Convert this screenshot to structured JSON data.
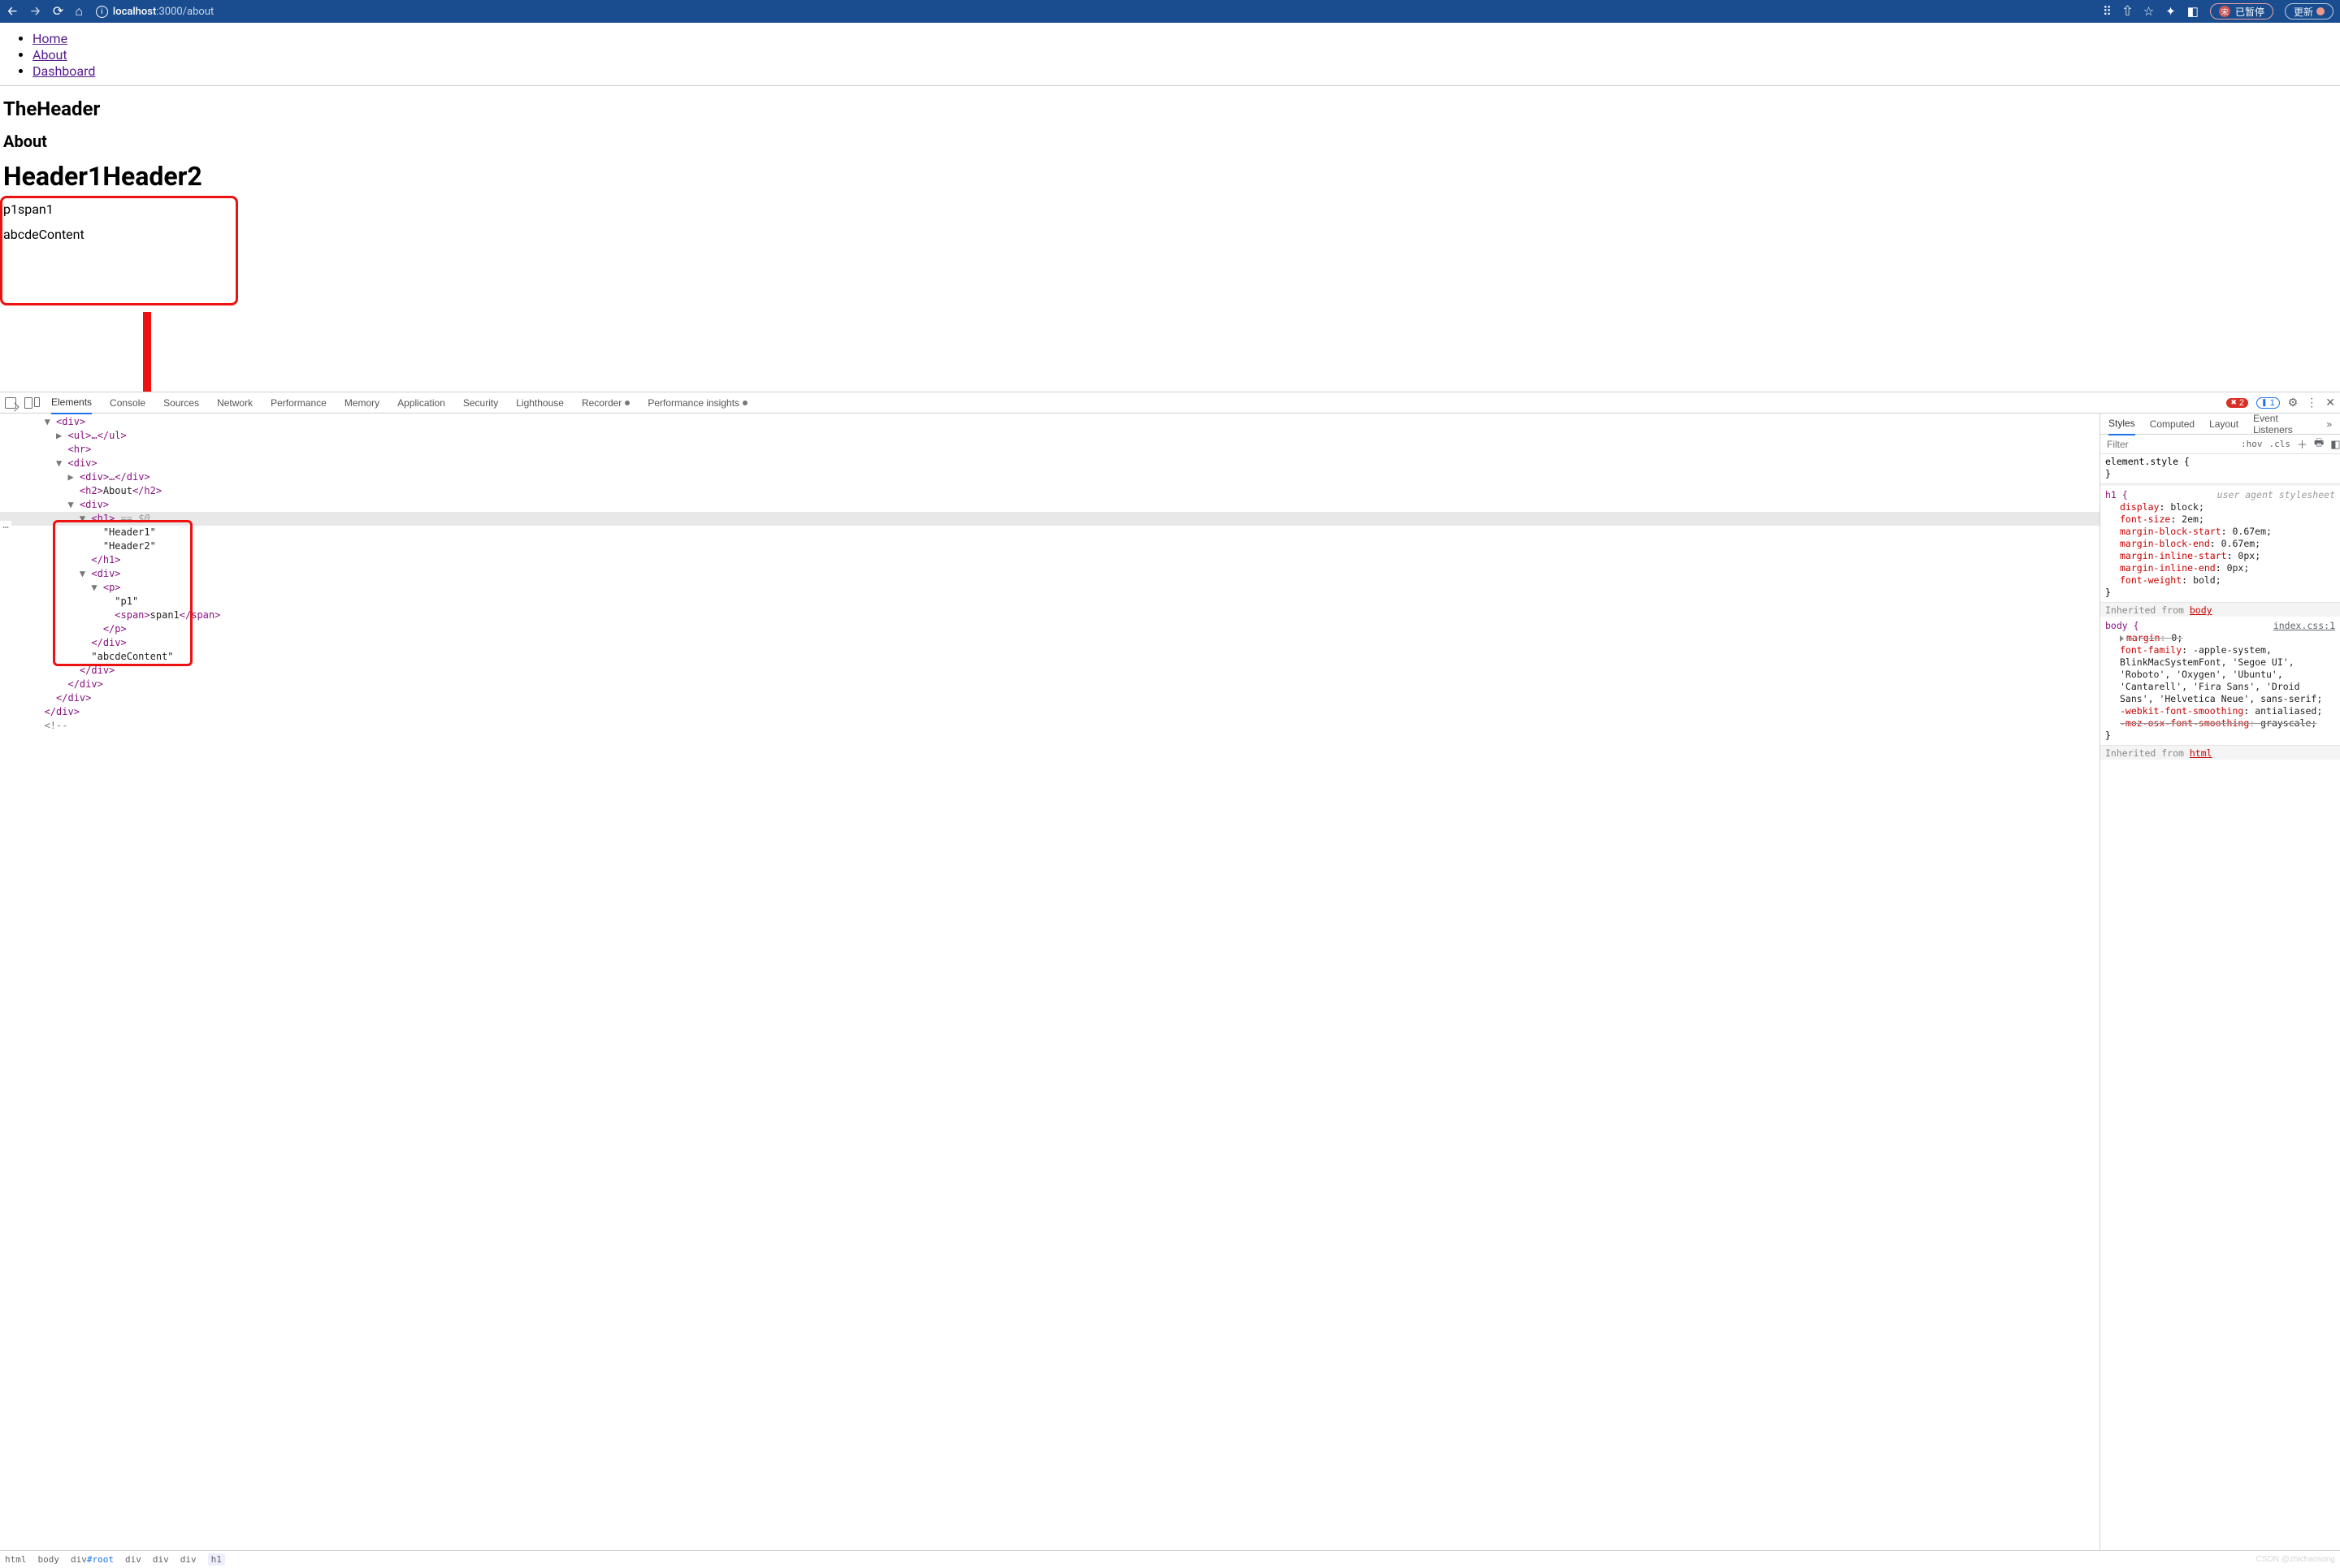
{
  "browser": {
    "url_host": "localhost",
    "url_port_path": ":3000/about",
    "avatar_initial": "宋",
    "avatar_status": "已暂停",
    "update_label": "更新"
  },
  "page": {
    "nav": [
      {
        "label": "Home"
      },
      {
        "label": "About"
      },
      {
        "label": "Dashboard"
      }
    ],
    "the_header": "TheHeader",
    "about_h2": "About",
    "h1_a": "Header1",
    "h1_b": "Header2",
    "p1": "p1",
    "span1": "span1",
    "tail": "abcdeContent"
  },
  "devtools": {
    "tabs": [
      "Elements",
      "Console",
      "Sources",
      "Network",
      "Performance",
      "Memory",
      "Application",
      "Security",
      "Lighthouse",
      "Recorder",
      "Performance insights"
    ],
    "active_tab": "Elements",
    "errors": "2",
    "infos": "1",
    "styles_tabs": [
      "Styles",
      "Computed",
      "Layout",
      "Event Listeners"
    ],
    "styles_active": "Styles",
    "filter_placeholder": "Filter",
    "hov": ":hov",
    "cls": ".cls",
    "rules": {
      "element_style": "element.style {",
      "h1_sel": "h1 {",
      "ua_note": "user agent stylesheet",
      "h1_props": [
        {
          "p": "display",
          "v": "block;"
        },
        {
          "p": "font-size",
          "v": "2em;"
        },
        {
          "p": "margin-block-start",
          "v": "0.67em;"
        },
        {
          "p": "margin-block-end",
          "v": "0.67em;"
        },
        {
          "p": "margin-inline-start",
          "v": "0px;"
        },
        {
          "p": "margin-inline-end",
          "v": "0px;"
        },
        {
          "p": "font-weight",
          "v": "bold;"
        }
      ],
      "inh_body": "Inherited from",
      "inh_body_kw": "body",
      "body_sel": "body {",
      "body_src": "index.css:1",
      "body_props": [
        {
          "p": "margin",
          "v": "0;",
          "strike": true,
          "tri": true
        },
        {
          "p": "font-family",
          "v": "-apple-system,"
        },
        {
          "cont": "BlinkMacSystemFont, 'Segoe UI',"
        },
        {
          "cont": "'Roboto', 'Oxygen', 'Ubuntu',"
        },
        {
          "cont": "'Cantarell', 'Fira Sans', 'Droid"
        },
        {
          "cont": "Sans', 'Helvetica Neue', sans-serif;"
        },
        {
          "p": "-webkit-font-smoothing",
          "v": "antialiased;"
        },
        {
          "p": "-moz-osx-font-smoothing",
          "v": "grayscale;",
          "strike": true
        }
      ],
      "inh_html": "Inherited from",
      "inh_html_kw": "html"
    },
    "tree": {
      "l0": "<div>",
      "l1": "<ul>…</ul>",
      "l2": "<hr>",
      "l3": "<div>",
      "l4": "<div>…</div>",
      "l5o": "<h2>",
      "l5t": "About",
      "l5c": "</h2>",
      "l6": "<div>",
      "l7": "<h1>",
      "l7eq": " == $0",
      "l8": "\"Header1\"",
      "l9": "\"Header2\"",
      "l10": "</h1>",
      "l11": "<div>",
      "l12": "<p>",
      "l13": "\"p1\"",
      "l14o": "<span>",
      "l14t": "span1",
      "l14c": "</span>",
      "l15": "</p>",
      "l16": "</div>",
      "l17": "\"abcdeContent\"",
      "l18": "</div>",
      "l19": "</div>",
      "l20": "</div>",
      "l21": "</div>",
      "l22": "<!--"
    },
    "breadcrumb": [
      "html",
      "body",
      "div#root",
      "div",
      "div",
      "div",
      "h1"
    ],
    "watermark": "CSDN @zhichaosong"
  }
}
